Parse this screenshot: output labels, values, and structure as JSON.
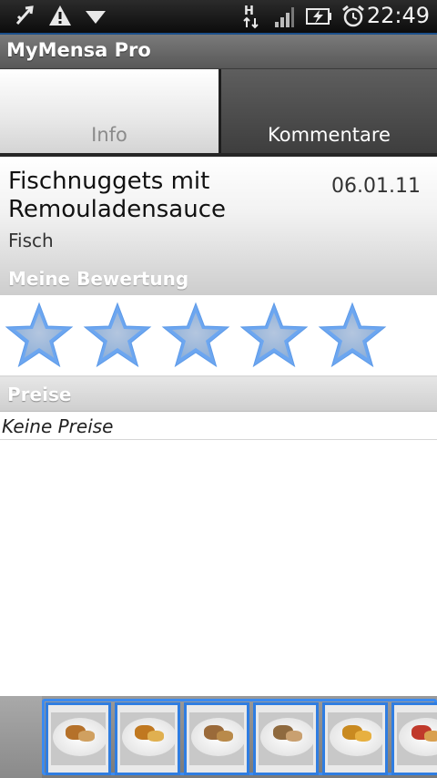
{
  "status_bar": {
    "time": "22:49",
    "network_type": "H",
    "icons": [
      "usb-debug-icon",
      "warning-icon",
      "notification-down-icon",
      "network-h-icon",
      "signal-icon",
      "battery-charging-icon",
      "alarm-icon"
    ]
  },
  "app": {
    "title": "MyMensa Pro"
  },
  "tabs": [
    {
      "label": "Info",
      "selected": true
    },
    {
      "label": "Kommentare",
      "selected": false
    }
  ],
  "meal": {
    "name": "Fischnuggets mit Remouladensauce",
    "date": "06.01.11",
    "category": "Fisch"
  },
  "rating": {
    "title": "Meine Bewertung",
    "max": 5,
    "value": 0,
    "star_color": "#8fb0d8"
  },
  "prices": {
    "title": "Preise",
    "text": "Keine Preise"
  },
  "gallery": {
    "count_visible": 6,
    "accent": "#2f7de1"
  }
}
